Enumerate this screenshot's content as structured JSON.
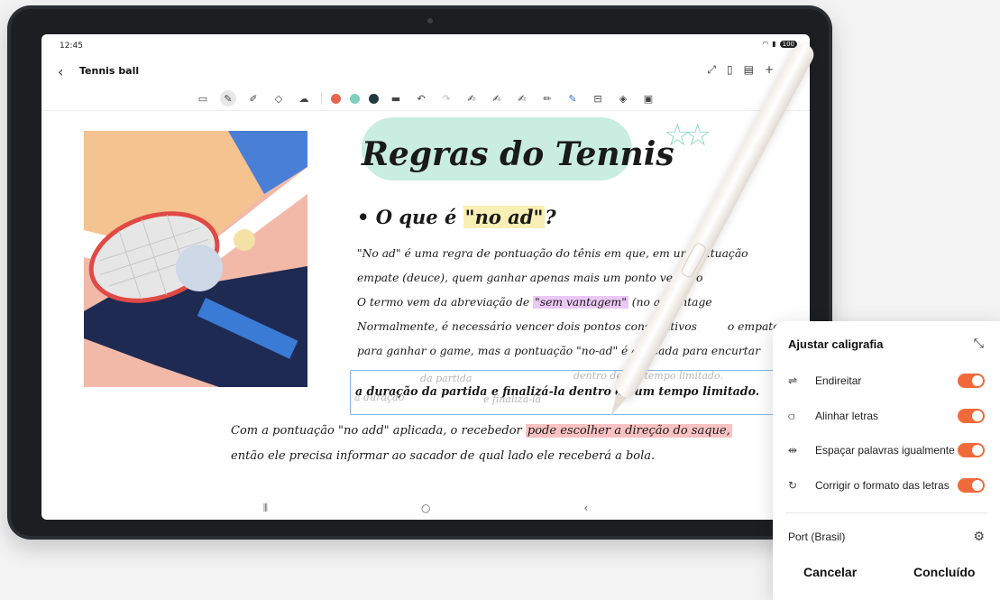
{
  "status": {
    "time": "12:45",
    "battery": "100"
  },
  "app": {
    "title": "Tennis ball"
  },
  "toolbar": {
    "colors": [
      "#e8644a",
      "#7fcfbd",
      "#1f3a40"
    ]
  },
  "note": {
    "heading": "Regras do Tennis",
    "bullet_prefix": "• O que é ",
    "bullet_highlight": "\"no ad\"",
    "bullet_suffix": "?",
    "line1": "\"No ad\" é uma regra de pontuação do tênis em que, em uma situação",
    "line2": "empate (deuce), quem ganhar apenas mais um ponto vence o",
    "line3_prefix": "O termo vem da abreviação de ",
    "line3_highlight": "\"sem vantagem\"",
    "line3_suffix": " (no advantage",
    "line4": "Normalmente, é necessário vencer dois pontos consecutivos",
    "line4_end": "o empate",
    "line5": "para ganhar o game, mas a pontuação \"no-ad\" é aplicada para encurtar",
    "ghost_a": "da partida",
    "ghost_b": "dentro de um tempo limitado.",
    "ghost_c": "a duração",
    "ghost_d": "e finalizá-la",
    "selected_line": "a duração da partida e finalizá-la dentro de um tempo limitado.",
    "bottom1_prefix": "Com a pontuação \"no add\" aplicada, o recebedor ",
    "bottom1_highlight": "pode escolher a direção do saque,",
    "bottom2": "então ele precisa informar ao sacador de qual lado ele receberá a bola."
  },
  "panel": {
    "title": "Ajustar caligrafia",
    "options": [
      {
        "label": "Endireitar",
        "icon": "straighten-icon",
        "enabled": true
      },
      {
        "label": "Alinhar letras",
        "icon": "align-letters-icon",
        "enabled": true
      },
      {
        "label": "Espaçar palavras igualmente",
        "icon": "space-words-icon",
        "enabled": true
      },
      {
        "label": "Corrigir o formato das letras",
        "icon": "fix-letter-shape-icon",
        "enabled": true
      }
    ],
    "language": "Port (Brasil)",
    "cancel": "Cancelar",
    "done": "Concluído"
  }
}
